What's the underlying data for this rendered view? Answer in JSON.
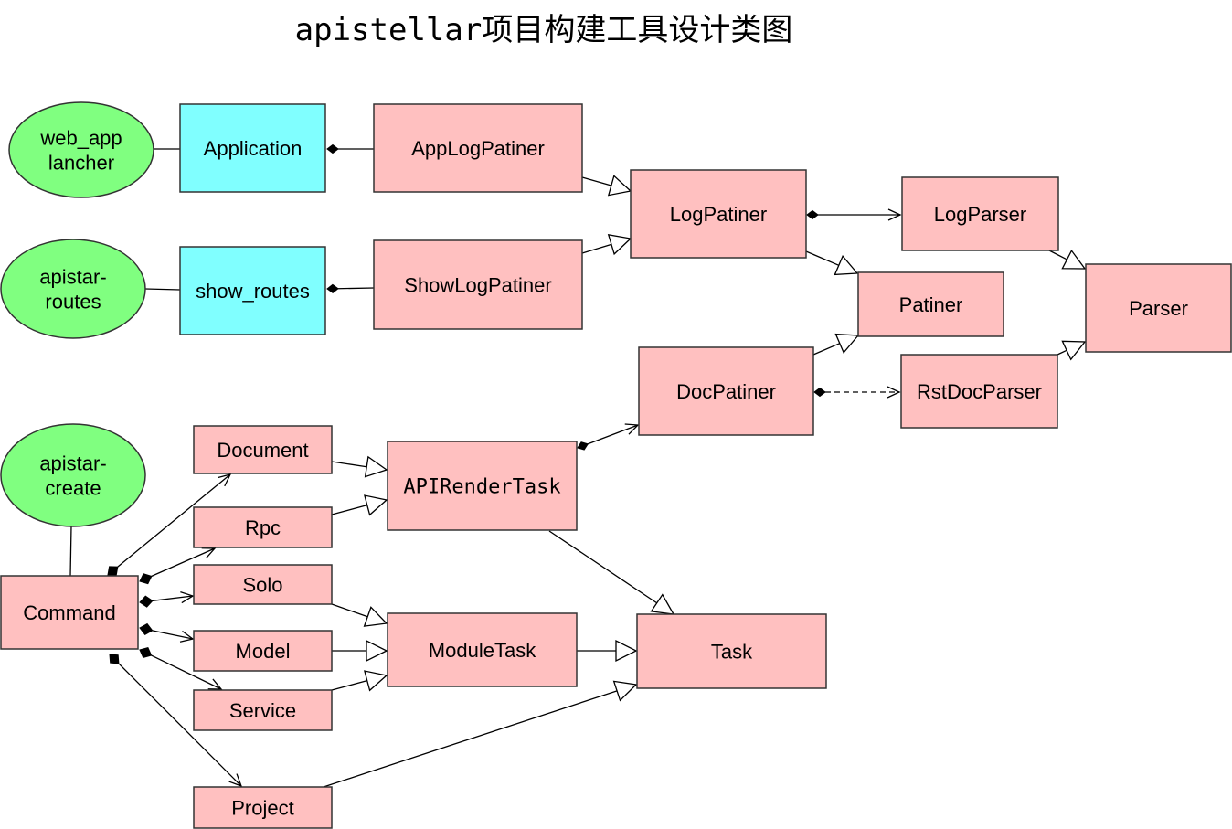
{
  "title": "apistellar项目构建工具设计类图",
  "colors": {
    "actor": "#80ff80",
    "boundary": "#80ffff",
    "class": "#ffc0c0",
    "stroke": "#333333"
  },
  "nodes": [
    {
      "id": "web_app_lancher",
      "label": [
        "web_app",
        "lancher"
      ],
      "shape": "ellipse",
      "kind": "actor"
    },
    {
      "id": "apistar_routes",
      "label": [
        "apistar-",
        "routes"
      ],
      "shape": "ellipse",
      "kind": "actor"
    },
    {
      "id": "apistar_create",
      "label": [
        "apistar-",
        "create"
      ],
      "shape": "ellipse",
      "kind": "actor"
    },
    {
      "id": "Application",
      "label": [
        "Application"
      ],
      "shape": "rect",
      "kind": "boundary"
    },
    {
      "id": "show_routes",
      "label": [
        "show_routes"
      ],
      "shape": "rect",
      "kind": "boundary"
    },
    {
      "id": "AppLogPatiner",
      "label": [
        "AppLogPatiner"
      ],
      "shape": "rect",
      "kind": "class"
    },
    {
      "id": "ShowLogPatiner",
      "label": [
        "ShowLogPatiner"
      ],
      "shape": "rect",
      "kind": "class"
    },
    {
      "id": "LogPatiner",
      "label": [
        "LogPatiner"
      ],
      "shape": "rect",
      "kind": "class"
    },
    {
      "id": "LogParser",
      "label": [
        "LogParser"
      ],
      "shape": "rect",
      "kind": "class"
    },
    {
      "id": "Patiner",
      "label": [
        "Patiner"
      ],
      "shape": "rect",
      "kind": "class"
    },
    {
      "id": "Parser",
      "label": [
        "Parser"
      ],
      "shape": "rect",
      "kind": "class"
    },
    {
      "id": "DocPatiner",
      "label": [
        "DocPatiner"
      ],
      "shape": "rect",
      "kind": "class"
    },
    {
      "id": "RstDocParser",
      "label": [
        "RstDocParser"
      ],
      "shape": "rect",
      "kind": "class"
    },
    {
      "id": "Document",
      "label": [
        "Document"
      ],
      "shape": "rect",
      "kind": "class"
    },
    {
      "id": "Rpc",
      "label": [
        "Rpc"
      ],
      "shape": "rect",
      "kind": "class"
    },
    {
      "id": "Solo",
      "label": [
        "Solo"
      ],
      "shape": "rect",
      "kind": "class"
    },
    {
      "id": "Model",
      "label": [
        "Model"
      ],
      "shape": "rect",
      "kind": "class"
    },
    {
      "id": "Service",
      "label": [
        "Service"
      ],
      "shape": "rect",
      "kind": "class"
    },
    {
      "id": "Project",
      "label": [
        "Project"
      ],
      "shape": "rect",
      "kind": "class"
    },
    {
      "id": "Command",
      "label": [
        "Command"
      ],
      "shape": "rect",
      "kind": "class"
    },
    {
      "id": "APIRenderTask",
      "label": [
        "APIRenderTask"
      ],
      "shape": "rect",
      "kind": "class",
      "mono": true
    },
    {
      "id": "ModuleTask",
      "label": [
        "ModuleTask"
      ],
      "shape": "rect",
      "kind": "class"
    },
    {
      "id": "Task",
      "label": [
        "Task"
      ],
      "shape": "rect",
      "kind": "class"
    }
  ],
  "edges": [
    {
      "from": "web_app_lancher",
      "to": "Application",
      "type": "association"
    },
    {
      "from": "apistar_routes",
      "to": "show_routes",
      "type": "association"
    },
    {
      "from": "apistar_create",
      "to": "Command",
      "type": "association"
    },
    {
      "from": "Application",
      "to": "AppLogPatiner",
      "type": "composition"
    },
    {
      "from": "show_routes",
      "to": "ShowLogPatiner",
      "type": "composition"
    },
    {
      "from": "AppLogPatiner",
      "to": "LogPatiner",
      "type": "inheritance"
    },
    {
      "from": "ShowLogPatiner",
      "to": "LogPatiner",
      "type": "inheritance"
    },
    {
      "from": "LogPatiner",
      "to": "LogParser",
      "type": "composition-navigable"
    },
    {
      "from": "LogPatiner",
      "to": "Patiner",
      "type": "inheritance"
    },
    {
      "from": "DocPatiner",
      "to": "Patiner",
      "type": "inheritance"
    },
    {
      "from": "DocPatiner",
      "to": "RstDocParser",
      "type": "composition-dependency"
    },
    {
      "from": "LogParser",
      "to": "Parser",
      "type": "inheritance"
    },
    {
      "from": "RstDocParser",
      "to": "Parser",
      "type": "inheritance"
    },
    {
      "from": "APIRenderTask",
      "to": "DocPatiner",
      "type": "composition-navigable"
    },
    {
      "from": "Document",
      "to": "APIRenderTask",
      "type": "inheritance"
    },
    {
      "from": "Rpc",
      "to": "APIRenderTask",
      "type": "inheritance"
    },
    {
      "from": "Solo",
      "to": "ModuleTask",
      "type": "inheritance"
    },
    {
      "from": "Model",
      "to": "ModuleTask",
      "type": "inheritance"
    },
    {
      "from": "Service",
      "to": "ModuleTask",
      "type": "inheritance"
    },
    {
      "from": "APIRenderTask",
      "to": "Task",
      "type": "inheritance"
    },
    {
      "from": "ModuleTask",
      "to": "Task",
      "type": "inheritance"
    },
    {
      "from": "Project",
      "to": "Task",
      "type": "inheritance"
    },
    {
      "from": "Command",
      "to": "Document",
      "type": "composition-navigable"
    },
    {
      "from": "Command",
      "to": "Rpc",
      "type": "composition-navigable"
    },
    {
      "from": "Command",
      "to": "Solo",
      "type": "composition-navigable"
    },
    {
      "from": "Command",
      "to": "Model",
      "type": "composition-navigable"
    },
    {
      "from": "Command",
      "to": "Service",
      "type": "composition-navigable"
    },
    {
      "from": "Command",
      "to": "Project",
      "type": "composition-navigable"
    }
  ]
}
